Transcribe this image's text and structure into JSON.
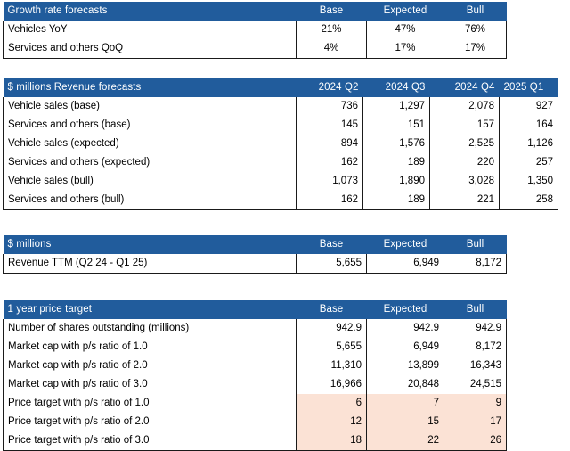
{
  "colors": {
    "header_blue": "#215C9C",
    "highlight_peach": "#FBE2D5",
    "grid_line": "#1a1a1a",
    "header_text": "#ffffff",
    "body_text": "#000000"
  },
  "tables": [
    {
      "id": "growth",
      "title": "Growth rate forecasts",
      "columns": [
        "Base",
        "Expected",
        "Bull"
      ],
      "align": "center",
      "rows": [
        {
          "label": "Vehicles YoY",
          "values": [
            "21%",
            "47%",
            "76%"
          ],
          "highlight": false
        },
        {
          "label": "Services and others QoQ",
          "values": [
            "4%",
            "17%",
            "17%"
          ],
          "highlight": false
        }
      ]
    },
    {
      "id": "revenue",
      "title": "$ millions Revenue forecasts",
      "columns": [
        "2024 Q2",
        "2024 Q3",
        "2024 Q4",
        "2025 Q1"
      ],
      "align": "right",
      "rows": [
        {
          "label": "Vehicle sales (base)",
          "values": [
            "736",
            "1,297",
            "2,078",
            "927"
          ],
          "highlight": false
        },
        {
          "label": "Services and others (base)",
          "values": [
            "145",
            "151",
            "157",
            "164"
          ],
          "highlight": false
        },
        {
          "label": "Vehicle sales  (expected)",
          "values": [
            "894",
            "1,576",
            "2,525",
            "1,126"
          ],
          "highlight": false
        },
        {
          "label": "Services and others (expected)",
          "values": [
            "162",
            "189",
            "220",
            "257"
          ],
          "highlight": false
        },
        {
          "label": "Vehicle sales (bull)",
          "values": [
            "1,073",
            "1,890",
            "3,028",
            "1,350"
          ],
          "highlight": false
        },
        {
          "label": "Services and others (bull)",
          "values": [
            "162",
            "189",
            "221",
            "258"
          ],
          "highlight": false
        }
      ]
    },
    {
      "id": "ttm",
      "title": "$ millions",
      "columns": [
        "Base",
        "Expected",
        "Bull"
      ],
      "align": "right",
      "rows": [
        {
          "label": "Revenue TTM (Q2 24 - Q1 25)",
          "values": [
            "5,655",
            "6,949",
            "8,172"
          ],
          "highlight": false
        }
      ]
    },
    {
      "id": "target",
      "title": "1 year price target",
      "columns": [
        "Base",
        "Expected",
        "Bull"
      ],
      "align": "right",
      "rows": [
        {
          "label": "Number of shares outstanding (millions)",
          "values": [
            "942.9",
            "942.9",
            "942.9"
          ],
          "highlight": false
        },
        {
          "label": "Market cap with p/s ratio of 1.0",
          "values": [
            "5,655",
            "6,949",
            "8,172"
          ],
          "highlight": false
        },
        {
          "label": "Market cap with p/s ratio of 2.0",
          "values": [
            "11,310",
            "13,899",
            "16,343"
          ],
          "highlight": false
        },
        {
          "label": "Market cap with p/s ratio of 3.0",
          "values": [
            "16,966",
            "20,848",
            "24,515"
          ],
          "highlight": false
        },
        {
          "label": "Price target with p/s ratio of 1.0",
          "values": [
            "6",
            "7",
            "9"
          ],
          "highlight": true
        },
        {
          "label": "Price target with p/s ratio of 2.0",
          "values": [
            "12",
            "15",
            "17"
          ],
          "highlight": true
        },
        {
          "label": "Price target with p/s ratio of 3.0",
          "values": [
            "18",
            "22",
            "26"
          ],
          "highlight": true
        }
      ]
    }
  ]
}
